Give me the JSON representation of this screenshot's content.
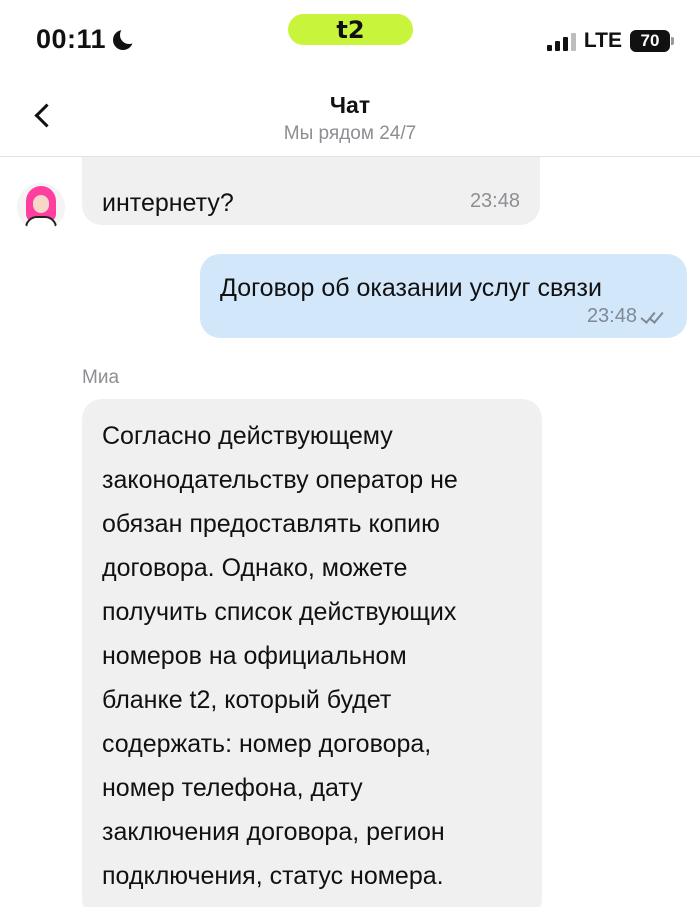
{
  "status_bar": {
    "time": "00:11",
    "carrier_logo": "t2",
    "network": "LTE",
    "battery": "70",
    "icons": [
      "moon-icon",
      "signal-icon",
      "battery-icon"
    ]
  },
  "header": {
    "title": "Чат",
    "subtitle": "Мы рядом 24/7",
    "back_icon": "chevron-left-icon"
  },
  "messages": [
    {
      "direction": "incoming",
      "text": "интернету?",
      "time": "23:48"
    },
    {
      "direction": "outgoing",
      "text": "Договор об оказании услуг связи",
      "time": "23:48",
      "status": "read"
    },
    {
      "direction": "incoming",
      "sender": "Миа",
      "lines": [
        "Согласно действующему",
        "законодательству оператор не",
        "обязан предоставлять копию",
        "договора. Однако, можете",
        "получить список действующих",
        "номеров на официальном",
        "бланке t2, который будет",
        "содержать: номер договора,",
        "номер телефона, дату",
        "заключения договора, регион",
        "подключения, статус номера."
      ]
    }
  ],
  "colors": {
    "brand_green": "#c8f53c",
    "incoming_bubble": "#f0f0f0",
    "outgoing_bubble": "#d3e7fb",
    "secondary_text": "#8e8e93"
  }
}
